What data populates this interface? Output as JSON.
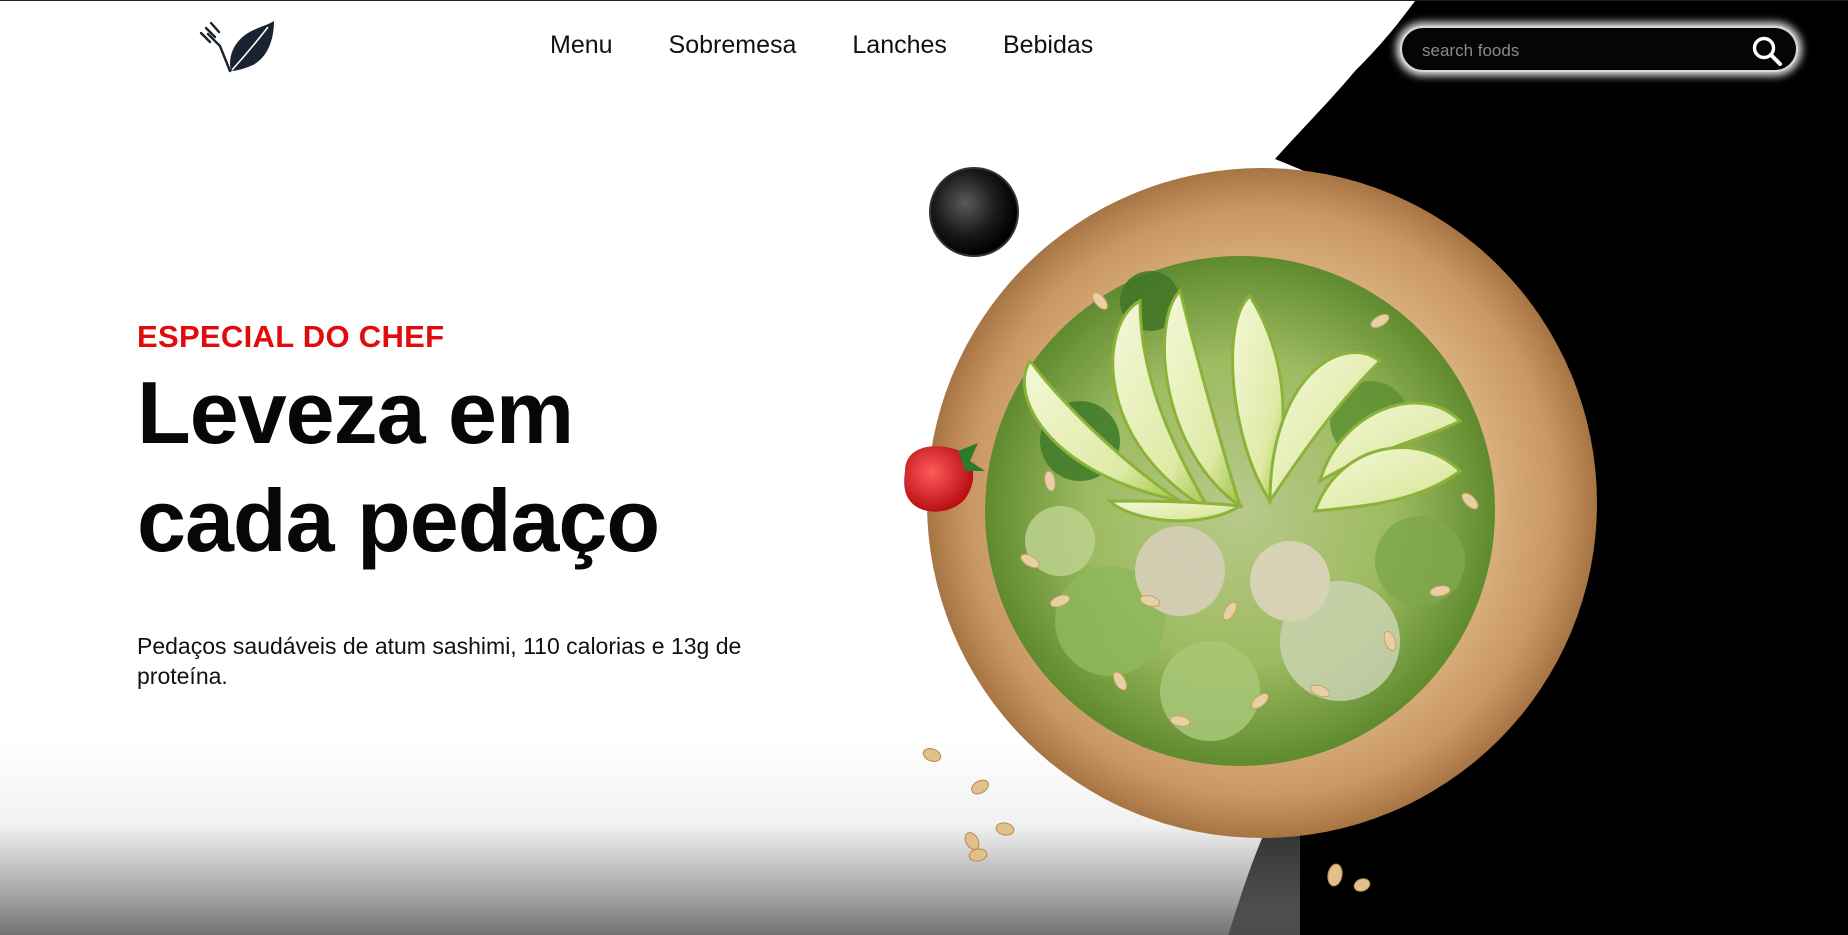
{
  "nav": {
    "logo_icon": "fork-leaf-logo-icon",
    "links": [
      {
        "label": "Menu"
      },
      {
        "label": "Sobremesa"
      },
      {
        "label": "Lanches"
      },
      {
        "label": "Bebidas"
      }
    ]
  },
  "search": {
    "placeholder": "search foods",
    "value": "",
    "icon": "search-icon"
  },
  "hero": {
    "eyebrow": "ESPECIAL DO CHEF",
    "title_line1": "Leveza em",
    "title_line2": "cada pedaço",
    "description": "Pedaços saudáveis de atum sashimi, 110 calorias e 13g de proteína."
  },
  "colors": {
    "accent": "#e10b0b",
    "background": "#ffffff",
    "dark_panel": "#000000",
    "search_bg": "#050505"
  }
}
